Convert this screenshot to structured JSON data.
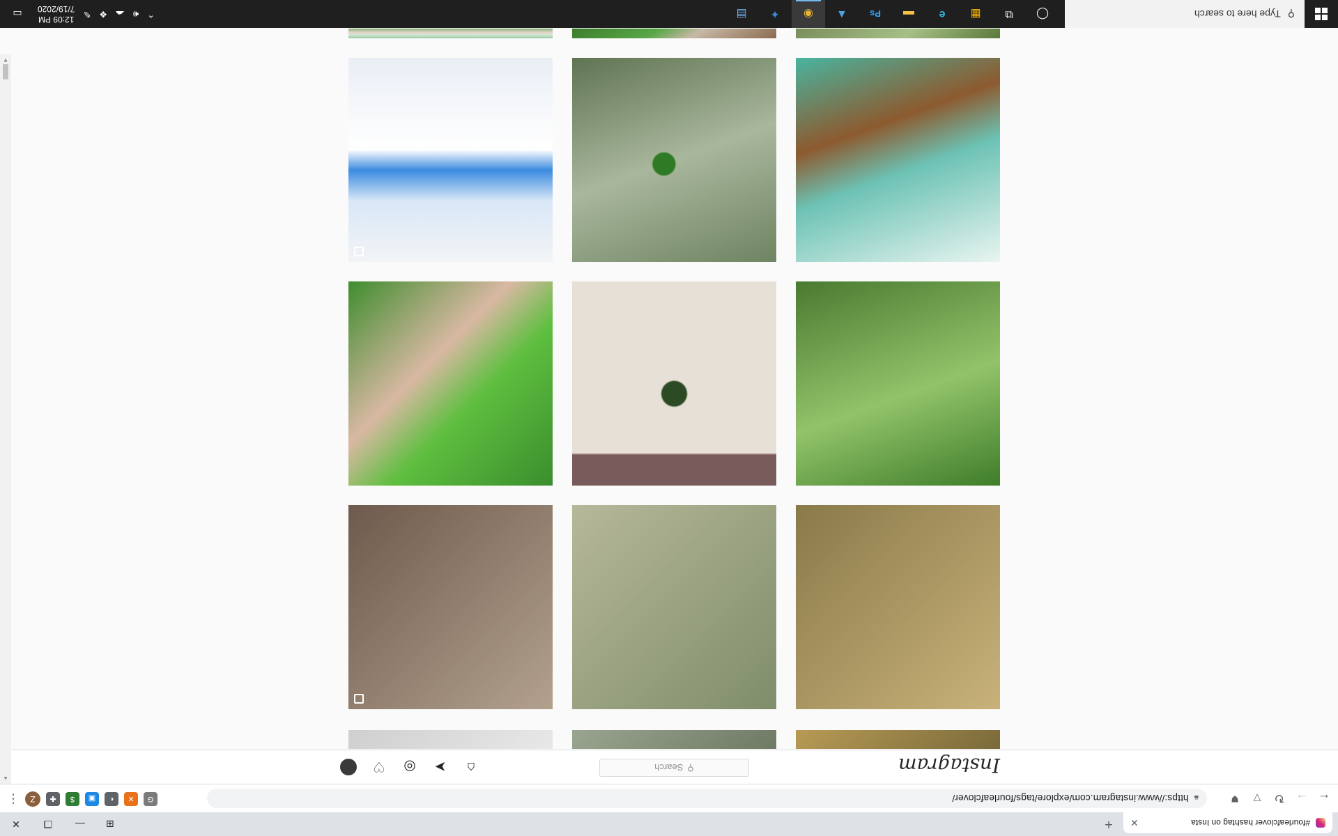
{
  "browser": {
    "tab_title": "#fourleafclover hashtag on Insta",
    "url": "https://www.instagram.com/explore/tags/fourleafclover/",
    "new_tab": "+",
    "tab_close": "✕",
    "profile_initial": "Z",
    "back": "←",
    "forward": "→",
    "reload": "↻",
    "menu": "⋮"
  },
  "instagram": {
    "logo": "Instagram",
    "search_placeholder": "Search",
    "search_icon": "magnifier-icon"
  },
  "posts": [
    {
      "bg": "linear-gradient(135deg,#c9b27a,#8a7a4a)"
    },
    {
      "bg": "linear-gradient(135deg,#7f8d6a,#b6b89a)"
    },
    {
      "bg": "linear-gradient(135deg,#b3a18e,#6e5a4c)"
    },
    {
      "bg": "linear-gradient(160deg,#3f7d2a,#92c36a 45%,#4a7a30)"
    },
    {
      "bg": "linear-gradient(180deg,#9ac7a2,#cfe9d2 35%,#e6d3c7 60%,#82b47a)"
    },
    {
      "bg": "linear-gradient(150deg,#8a6b4f,#c7b8a6 40%,#57a646 60%,#3d7d2c)"
    },
    {
      "bg": "linear-gradient(160deg,#e9f5f1,#6cc2b4 45%,#8d5a2f 65%,#49b49f)"
    },
    {
      "bg": "radial-gradient(circle at 50% 45%,#2c4a24 0 8%,transparent 9%),linear-gradient(180deg,#7a5b5b 0 15%,#e7e0d6 16%)"
    },
    {
      "bg": "linear-gradient(135deg,#3b8e2d,#5ebf3f 40%,#d9b8a3 60%,#3f8d2e)"
    },
    {
      "bg": "linear-gradient(135deg,#5a7a3a,#a6bf86 45%,#7a8e5c)"
    },
    {
      "bg": "radial-gradient(circle at 55% 48%,#2f7a25 0 7%,transparent 8%),linear-gradient(160deg,#6e8462,#a9b79c 50%,#5f7452)"
    },
    {
      "bg": "linear-gradient(180deg,#f2f4f6,#d9e7f7 30%,#3b8be0 45%,#ffffff 55%,#e9eef5)"
    },
    {
      "bg": "linear-gradient(135deg,#7a6a3a,#b79a55)"
    },
    {
      "bg": "linear-gradient(135deg,#6e7a63,#9aa590)"
    },
    {
      "bg": "linear-gradient(135deg,#e8e8e8,#cfcfcf)"
    }
  ],
  "taskbar": {
    "search_placeholder": "Type here to search",
    "time": "12:09 PM",
    "date": "7/19/2020",
    "apps": [
      {
        "name": "cortana",
        "glyph": "◯"
      },
      {
        "name": "task-view",
        "glyph": "⧉"
      },
      {
        "name": "store",
        "glyph": "▦"
      },
      {
        "name": "edge",
        "glyph": "e"
      },
      {
        "name": "file-explorer",
        "glyph": "▬"
      },
      {
        "name": "photoshop",
        "glyph": "Ps"
      },
      {
        "name": "photos",
        "glyph": "▲"
      },
      {
        "name": "chrome",
        "glyph": "◉"
      },
      {
        "name": "app",
        "glyph": "✦"
      },
      {
        "name": "calculator",
        "glyph": "▤"
      }
    ]
  }
}
